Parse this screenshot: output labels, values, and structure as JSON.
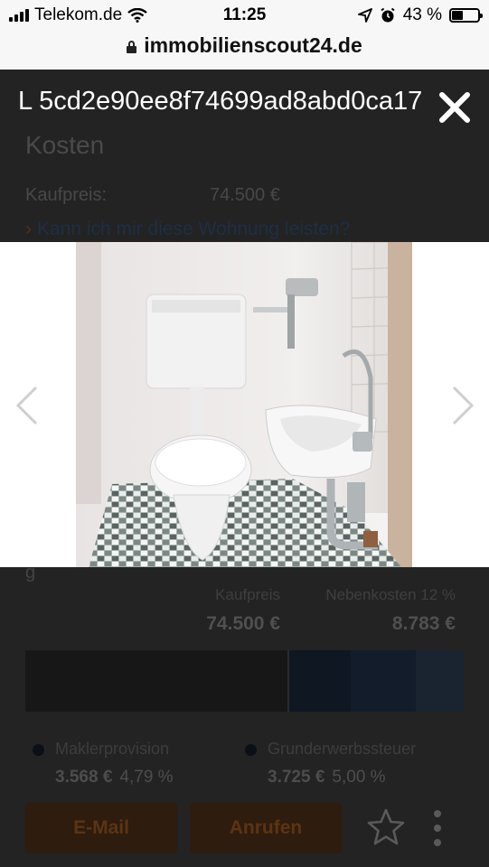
{
  "status_bar": {
    "carrier": "Telekom.de",
    "time": "11:25",
    "battery_text": "43 %",
    "battery_level": 0.43
  },
  "url_bar": {
    "domain": "immobilienscout24.de"
  },
  "lightbox": {
    "title": "L 5cd2e90ee8f74699ad8abd0ca17",
    "icons": {
      "close": "close-icon",
      "prev": "chevron-left-icon",
      "next": "chevron-right-icon"
    }
  },
  "page": {
    "section_title": "Kosten",
    "price_label": "Kaufpreis:",
    "price_value": "74.500 €",
    "afford_link": "Kann ich mir diese Wohnung leisten?",
    "fragment": "g",
    "breakdown": {
      "col1_label": "Kaufpreis",
      "col2_label": "Nebenkosten 12 %",
      "col1_value": "74.500 €",
      "col2_value": "8.783 €"
    },
    "legend": [
      {
        "label": "Maklerprovision",
        "amount": "3.568 €",
        "percent": "4,79 %"
      },
      {
        "label": "Grunderwerbssteuer",
        "amount": "3.725 €",
        "percent": "5,00 %"
      }
    ],
    "buttons": {
      "email": "E-Mail",
      "call": "Anrufen"
    },
    "icons": {
      "favorite": "star-icon",
      "more": "more-vertical-icon"
    }
  },
  "colors": {
    "page_bg": "#232323",
    "overlay_text": "#ffffff",
    "button_bg": "#2e1c0e",
    "link": "#1f2e45"
  }
}
